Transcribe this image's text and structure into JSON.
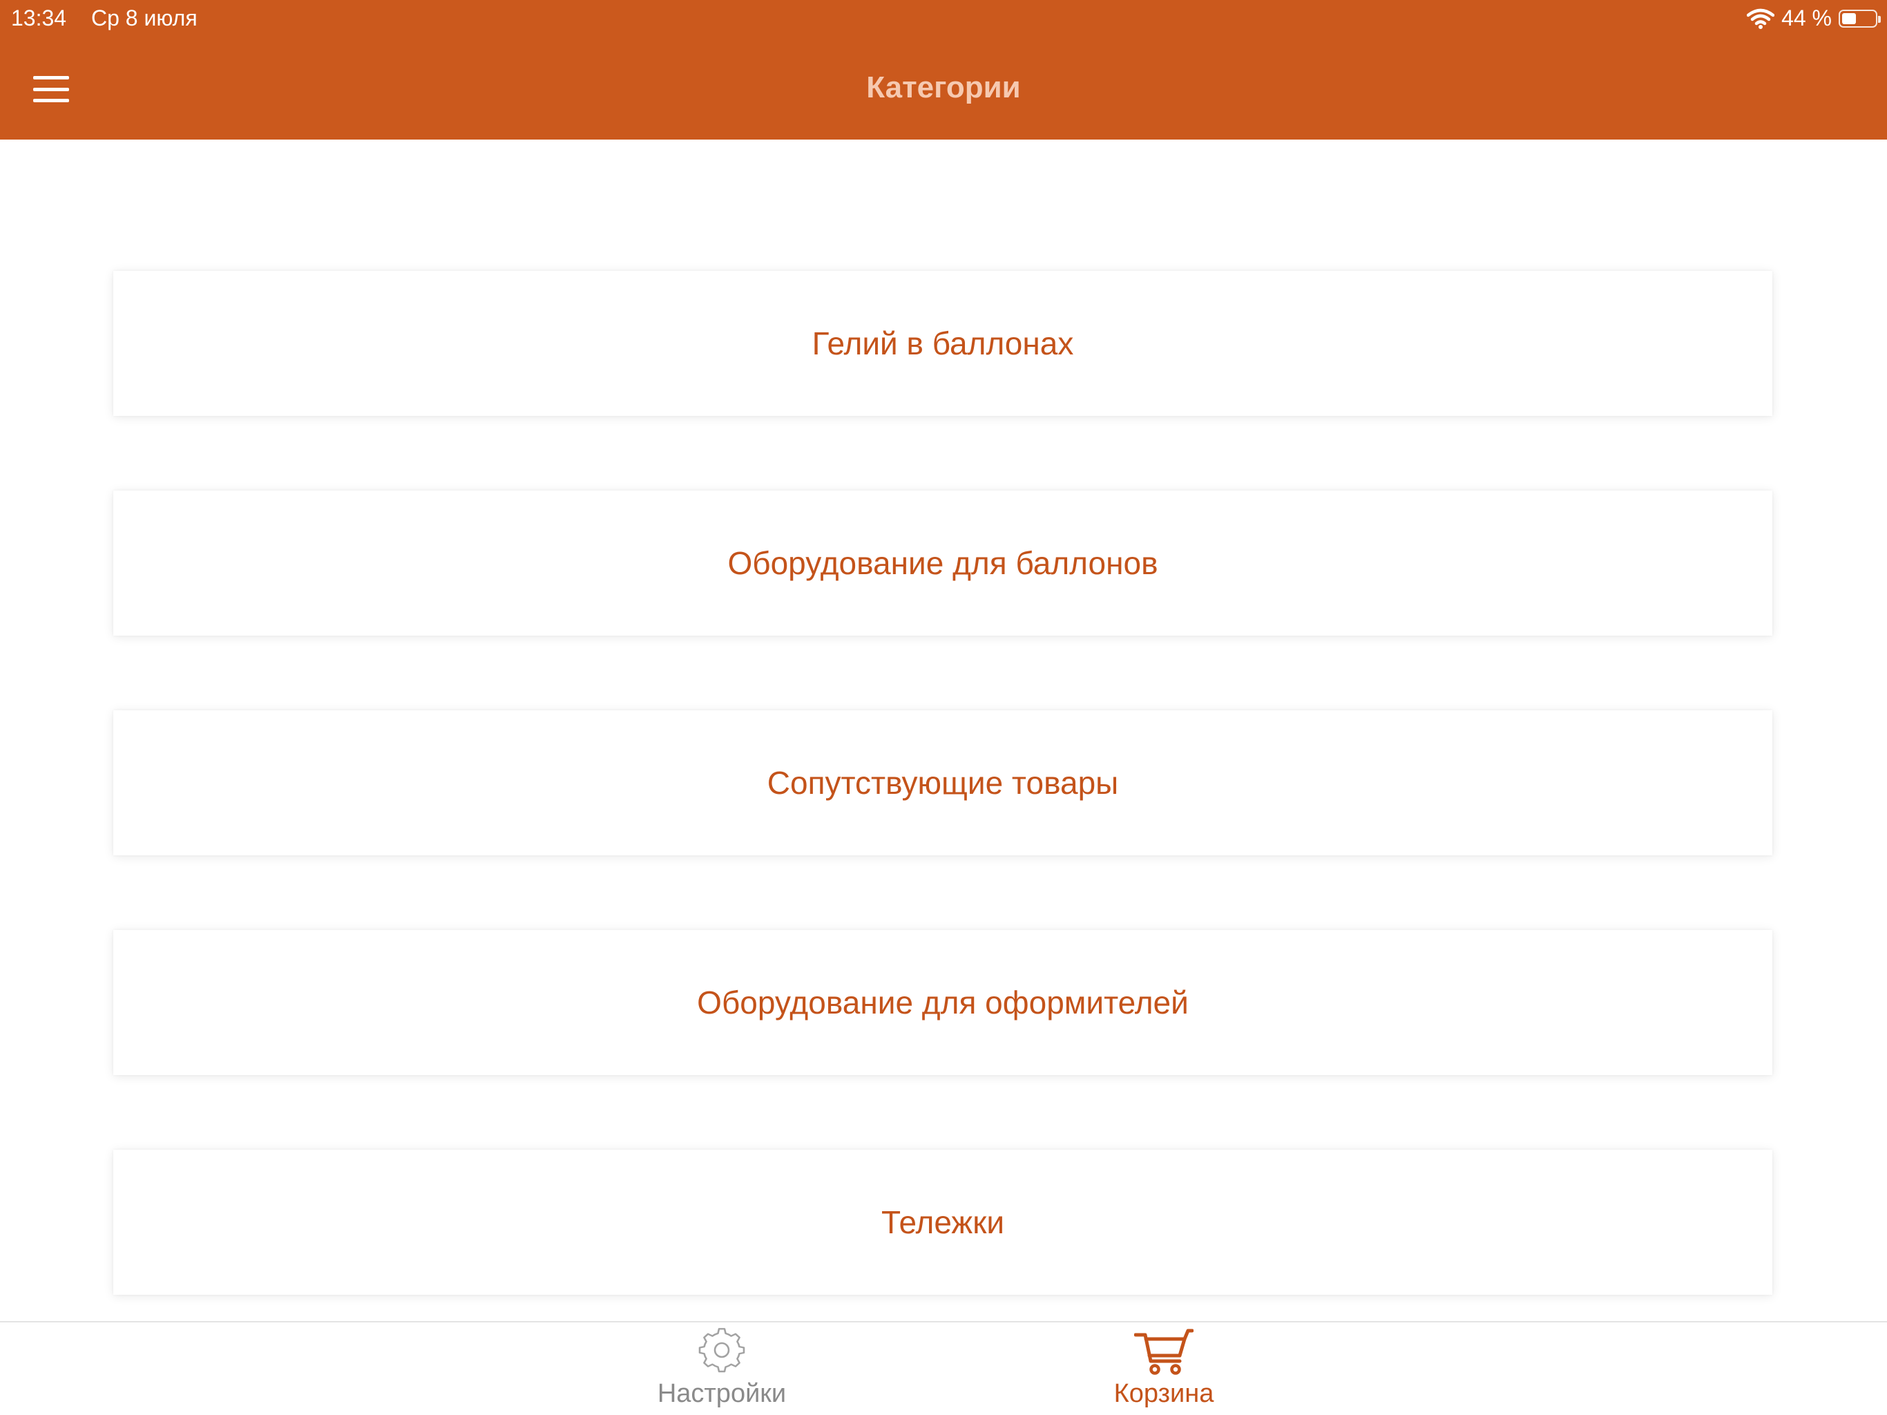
{
  "status_bar": {
    "time": "13:34",
    "date": "Ср 8 июля",
    "battery_text": "44 %",
    "battery_level": 0.44
  },
  "header": {
    "title": "Категории",
    "menu_icon": "hamburger-menu-icon"
  },
  "categories": [
    {
      "label": "Гелий в баллонах"
    },
    {
      "label": "Оборудование для баллонов"
    },
    {
      "label": "Сопутствующие товары"
    },
    {
      "label": "Оборудование для оформителей"
    },
    {
      "label": "Тележки"
    }
  ],
  "tabbar": {
    "settings": {
      "label": "Настройки",
      "icon": "gear-icon",
      "active": false
    },
    "cart": {
      "label": "Корзина",
      "icon": "cart-icon",
      "active": true
    }
  },
  "colors": {
    "accent": "#cb591d",
    "category_text": "#c4531a",
    "title_text": "#f6c9b0",
    "inactive_tab": "#8a8a8a"
  }
}
